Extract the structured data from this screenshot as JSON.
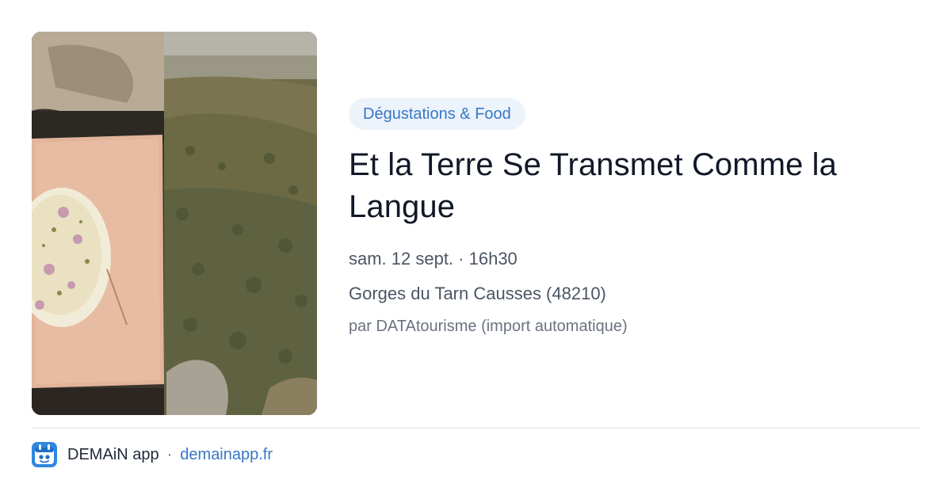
{
  "event": {
    "category": "Dégustations & Food",
    "title": "Et la Terre Se Transmet Comme la Langue",
    "datetime": "sam. 12 sept. · 16h30",
    "location": "Gorges du Tarn Causses (48210)",
    "author": "par DATAtourisme (import automatique)"
  },
  "footer": {
    "app_name": "DEMAiN app",
    "separator": "·",
    "link_text": "demainapp.fr",
    "app_icon": "demain-app-logo-icon"
  },
  "colors": {
    "accent": "#3777c8",
    "badge_bg": "#edf3fb",
    "title": "#111827",
    "meta": "#4b5563",
    "divider": "#d8e1ea"
  }
}
